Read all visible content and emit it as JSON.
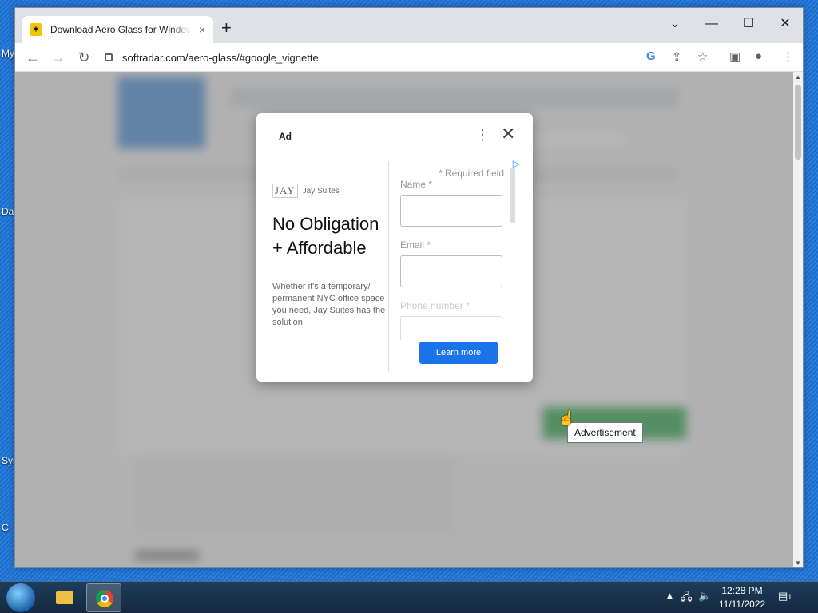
{
  "desktop": {
    "labels": [
      "My",
      "Da",
      "Sys",
      "C"
    ]
  },
  "browser": {
    "tab_title": "Download Aero Glass for Windows",
    "tab_close": "×",
    "new_tab": "+",
    "window_controls": {
      "dropdown": "⌄",
      "minimize": "—",
      "maximize": "☐",
      "close": "✕"
    },
    "url": "softradar.com/aero-glass/#google_vignette",
    "nav": {
      "back": "←",
      "forward": "→",
      "reload": "↻"
    },
    "toolbar_icons": [
      "google-icon",
      "share-icon",
      "star-icon",
      "sidebar-icon",
      "profile-icon",
      "menu-icon"
    ]
  },
  "ad": {
    "label": "Ad",
    "more": "⋮",
    "close": "✕",
    "brand_logo": "JAY",
    "brand_name": "Jay Suites",
    "headline": "No Obligation + Affordable",
    "body": "Whether it's a temporary/ permanent NYC office space you need, Jay Suites has the solution",
    "required_note": "* Required field",
    "fields": [
      {
        "label": "Name *"
      },
      {
        "label": "Email *"
      },
      {
        "label": "Phone number *"
      }
    ],
    "cta": "Learn more"
  },
  "tooltip": "Advertisement",
  "taskbar": {
    "time": "12:28 PM",
    "date": "11/11/2022",
    "notification_count": "1"
  },
  "colors": {
    "accent": "#1a73e8",
    "desktop": "#2a7fe0"
  }
}
